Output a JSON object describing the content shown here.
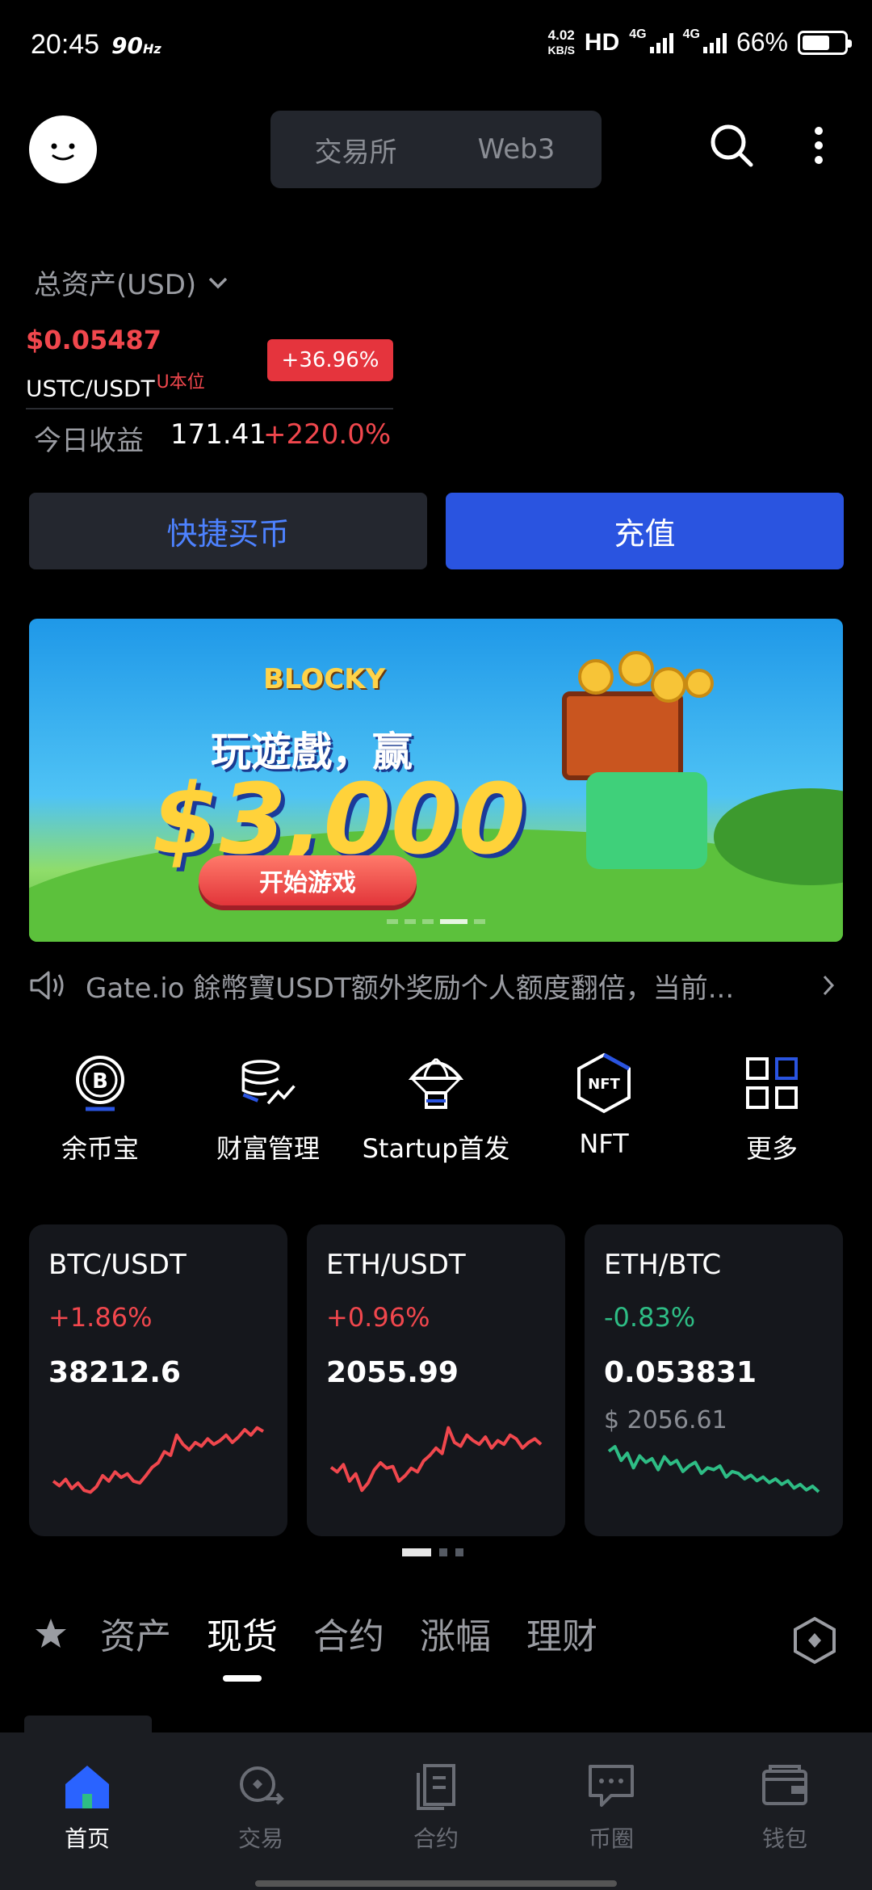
{
  "status_bar": {
    "time": "20:45",
    "refresh": "90",
    "refresh_unit": "Hz",
    "speed_value": "4.02",
    "speed_unit": "KB/S",
    "hd": "HD",
    "network_1": "4G",
    "network_2": "4G",
    "battery": "66%",
    "battery_level": 0.66
  },
  "header": {
    "tabs": [
      "交易所",
      "Web3"
    ],
    "active_tab": 0
  },
  "assets": {
    "title": "总资产(USD)",
    "ticker_price": "$0.05487",
    "ticker_pair": "USTC/USDT",
    "ticker_tag": "U本位",
    "ticker_change": "+36.96%",
    "today_label": "今日收益",
    "today_value": "171.41",
    "today_pct": "+220.0%"
  },
  "actions": {
    "quick_buy": "快捷买币",
    "deposit": "充值"
  },
  "banner": {
    "logo_text": "BLOCKY",
    "subtitle": "玩遊戲，赢",
    "amount": "$3,000",
    "cta": "开始游戏",
    "slides": 5,
    "active_slide": 3
  },
  "notice": {
    "text": "Gate.io 餘幣寶USDT额外奖励个人额度翻倍，当前..."
  },
  "shortcuts": [
    {
      "label": "余币宝",
      "icon": "coin-bitcoin-icon"
    },
    {
      "label": "财富管理",
      "icon": "wealth-stack-icon"
    },
    {
      "label": "Startup首发",
      "icon": "parachute-icon"
    },
    {
      "label": "NFT",
      "icon": "nft-hexagon-icon"
    },
    {
      "label": "更多",
      "icon": "grid-more-icon"
    }
  ],
  "markets": [
    {
      "pair": "BTC/USDT",
      "change": "+1.86%",
      "price": "38212.6",
      "usd": "",
      "trend": "up",
      "color": "#f0474d",
      "spark": [
        0.3,
        0.25,
        0.32,
        0.22,
        0.28,
        0.2,
        0.18,
        0.24,
        0.36,
        0.3,
        0.4,
        0.34,
        0.38,
        0.3,
        0.28,
        0.36,
        0.45,
        0.5,
        0.62,
        0.58,
        0.8,
        0.7,
        0.64,
        0.72,
        0.68,
        0.76,
        0.7,
        0.74,
        0.8,
        0.72,
        0.78,
        0.86,
        0.8,
        0.88,
        0.84
      ]
    },
    {
      "pair": "ETH/USDT",
      "change": "+0.96%",
      "price": "2055.99",
      "usd": "",
      "trend": "up",
      "color": "#f0474d",
      "spark": [
        0.45,
        0.4,
        0.48,
        0.3,
        0.38,
        0.2,
        0.28,
        0.42,
        0.5,
        0.44,
        0.46,
        0.3,
        0.36,
        0.44,
        0.4,
        0.52,
        0.58,
        0.66,
        0.6,
        0.88,
        0.72,
        0.68,
        0.8,
        0.74,
        0.7,
        0.78,
        0.66,
        0.74,
        0.7,
        0.8,
        0.76,
        0.66,
        0.72,
        0.76,
        0.7
      ]
    },
    {
      "pair": "ETH/BTC",
      "change": "-0.83%",
      "price": "0.053831",
      "usd": "$ 2056.61",
      "trend": "down",
      "color": "#2ebd85",
      "spark": [
        0.8,
        0.85,
        0.7,
        0.78,
        0.62,
        0.75,
        0.68,
        0.72,
        0.6,
        0.74,
        0.66,
        0.7,
        0.58,
        0.64,
        0.68,
        0.56,
        0.62,
        0.6,
        0.64,
        0.52,
        0.58,
        0.56,
        0.5,
        0.54,
        0.48,
        0.52,
        0.46,
        0.5,
        0.44,
        0.48,
        0.4,
        0.44,
        0.38,
        0.42,
        0.36
      ]
    }
  ],
  "market_pages": 3,
  "market_active_page": 0,
  "tabs": {
    "items": [
      "资产",
      "现货",
      "合约",
      "涨幅",
      "理财"
    ],
    "active": 1
  },
  "bottom_nav": [
    {
      "label": "首页",
      "icon": "home-icon",
      "active": true
    },
    {
      "label": "交易",
      "icon": "trade-icon",
      "active": false
    },
    {
      "label": "合约",
      "icon": "contract-icon",
      "active": false
    },
    {
      "label": "币圈",
      "icon": "community-icon",
      "active": false
    },
    {
      "label": "钱包",
      "icon": "wallet-icon",
      "active": false
    }
  ],
  "colors": {
    "up": "#f0474d",
    "down": "#2ebd85",
    "accent": "#2a54e0",
    "accent_text": "#4d82ff"
  }
}
